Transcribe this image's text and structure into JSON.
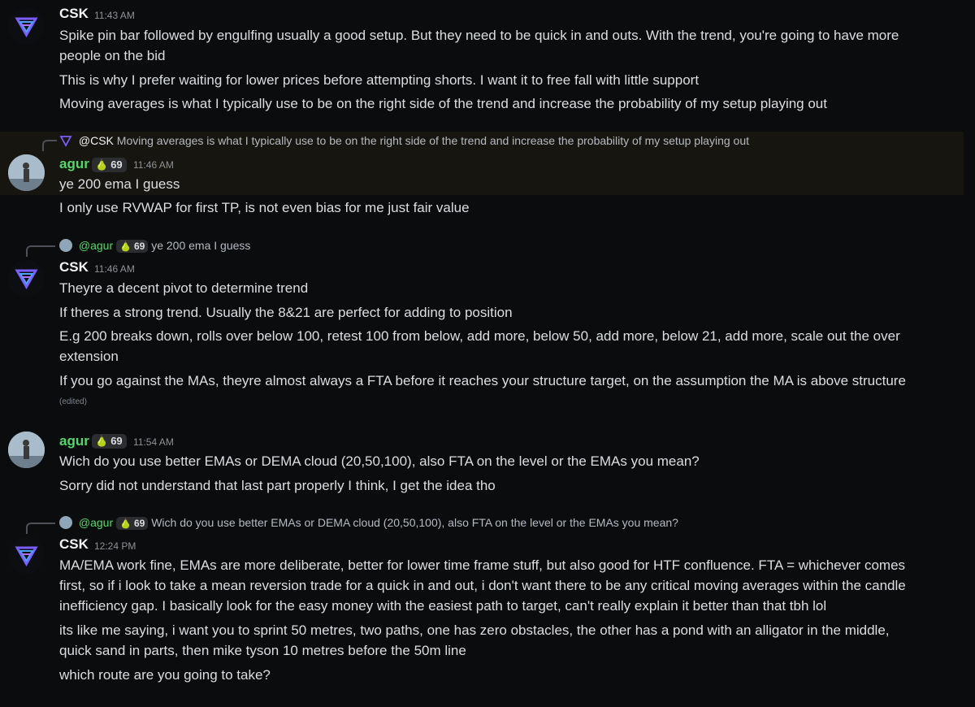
{
  "messages": {
    "m1": {
      "author": "CSK",
      "time": "11:43 AM",
      "lines": [
        "Spike pin bar followed by engulfing usually a good setup. But they need to be quick in and outs. With the trend, you're going to have more",
        "people on the bid",
        "This is why I prefer waiting for lower prices before attempting shorts. I want it to free fall with little support",
        "Moving averages is what I typically use to be on the right side of the trend and increase the probability of my setup playing out"
      ]
    },
    "m2": {
      "reply_to_name": "@CSK",
      "reply_to_text": "Moving averages is what I typically use to be on the right side of the trend and increase the probability of my setup playing out",
      "author": "agur",
      "badge": "69",
      "time": "11:46 AM",
      "lines": [
        "ye 200 ema I guess",
        "I only use RVWAP for first TP, is not even bias for me just fair value"
      ]
    },
    "m3": {
      "reply_to_name": "@agur",
      "reply_badge": "69",
      "reply_to_text": "ye 200 ema I guess",
      "author": "CSK",
      "time": "11:46 AM",
      "lines": [
        "Theyre a decent pivot to determine trend",
        "If theres a strong trend. Usually the 8&21 are perfect for adding to position",
        "E.g 200 breaks down, rolls over below 100, retest 100 from below, add more, below 50, add more, below 21, add more, scale out the over",
        "extension",
        "If you go against the MAs, theyre almost always a FTA before it reaches your structure target, on the assumption the MA is above structure"
      ],
      "edited": "(edited)"
    },
    "m4": {
      "author": "agur",
      "badge": "69",
      "time": "11:54 AM",
      "lines": [
        "Wich do you use better EMAs or DEMA cloud (20,50,100), also FTA on the level or the EMAs you mean?",
        "Sorry did not understand that last part properly I think, I get the idea tho"
      ]
    },
    "m5": {
      "reply_to_name": "@agur",
      "reply_badge": "69",
      "reply_to_text": "Wich do you use better EMAs or DEMA cloud (20,50,100), also FTA on the level or the EMAs you mean?",
      "author": "CSK",
      "time": "12:24 PM",
      "lines": [
        "MA/EMA work fine, EMAs are more deliberate, better for lower time frame stuff, but also good for HTF confluence. FTA = whichever comes",
        "first, so if i look to take a mean reversion trade for a quick in and out, i don't want there to be any critical moving averages within the candle",
        "inefficiency gap. I basically look for the easy money with the easiest path to target, can't really explain it better than that tbh lol",
        "its like me saying, i want you to sprint 50 metres, two paths, one has zero obstacles, the other has a pond with an alligator in the middle,",
        "quick sand in parts, then mike tyson 10 metres before the 50m line",
        "which route are you going to take?"
      ]
    }
  },
  "colors": {
    "background": "#0b0c0e",
    "highlight": "#17150f",
    "agur_name": "#55d66b",
    "csk_logo": "#7b5cff"
  },
  "icons": {
    "csk_avatar": "purple-triangle-logo-icon",
    "agur_avatar": "user-photo-avatar",
    "badge": "pear-icon"
  }
}
